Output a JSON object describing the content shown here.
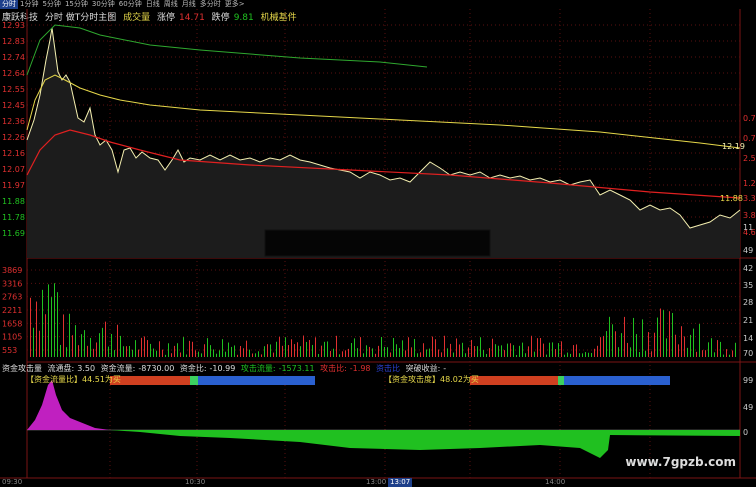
{
  "tabs": [
    "分时",
    "1分钟",
    "5分钟",
    "15分钟",
    "30分钟",
    "60分钟",
    "日线",
    "周线",
    "月线",
    "多分时",
    "更多>"
  ],
  "active_tab": 0,
  "title": {
    "name": "康跃科技",
    "chart_name": "分时 做T分时主图",
    "volume_label": "成交量",
    "limit_up_label": "涨停",
    "limit_up_value": "14.71",
    "limit_down_label": "跌停",
    "limit_down_value": "9.81",
    "sector": "机械基件"
  },
  "price_axis": [
    "12.93",
    "12.83",
    "12.74",
    "12.64",
    "12.55",
    "12.45",
    "12.36",
    "12.26",
    "12.16",
    "12.07",
    "11.97",
    "11.88",
    "11.78",
    "11.69"
  ],
  "volume_axis": [
    "3869",
    "3316",
    "2763",
    "2211",
    "1658",
    "1105",
    "553"
  ],
  "right_labels": [
    "0.7",
    "0.7",
    "2.5",
    "1.2",
    "3.3",
    "3.8",
    "4.6",
    "11",
    "49",
    "42",
    "35",
    "28",
    "21",
    "14",
    "70",
    "99",
    "49",
    "0"
  ],
  "price_tags": [
    "12.19",
    "11.88"
  ],
  "info_line": {
    "title": "资金攻击量",
    "float_label": "流通盘:",
    "float_value": "3.50",
    "flow_label": "资金流量:",
    "flow_value": "-8730.00",
    "ratio_label": "资金比:",
    "ratio_value": "-10.99",
    "attack_flow_label": "攻击流量:",
    "attack_flow_value": "-1573.11",
    "attack_ratio_label": "攻击比:",
    "attack_ratio_value": "-1.98",
    "extra_label": "资击比",
    "breakout_label": "突破收益:",
    "breakout_value": "-"
  },
  "bar_left": {
    "label": "【资金流量比】",
    "value": "44.51",
    "tag": "为买"
  },
  "bar_right": {
    "label": "【资金攻击度】",
    "value": "48.02",
    "tag": "为买"
  },
  "time_axis": [
    "09:30",
    "10:30",
    "13:00",
    "13:07",
    "14:00"
  ],
  "watermark": "www.7gpzb.com",
  "colors": {
    "price_line": "#f5f0b0",
    "avg_line_yellow": "#e6d84a",
    "avg_line_red": "#e02020",
    "green_line": "#2fa82f",
    "grid": "#5a1010",
    "up": "#e03030",
    "down": "#20c020",
    "magenta": "#c020c0"
  }
}
